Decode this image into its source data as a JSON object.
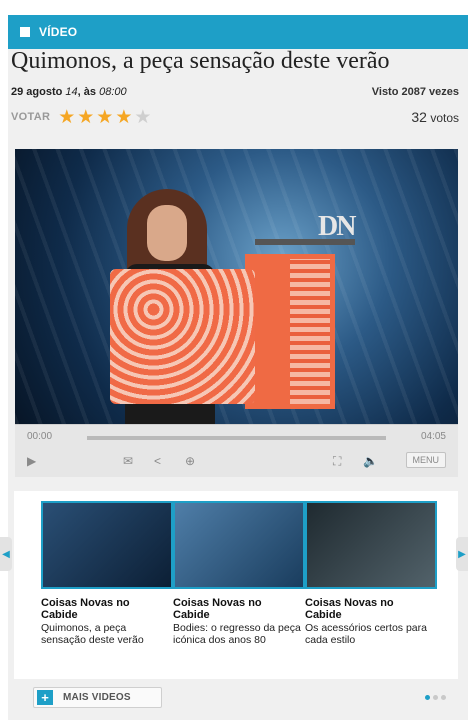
{
  "header": {
    "label": "VÍDEO"
  },
  "article": {
    "title": "Quimonos, a peça sensação deste verão",
    "date_main": "29 agosto",
    "date_year": "14",
    "date_sep": ", às",
    "date_time": "08:00",
    "views": "Visto 2087 vezes"
  },
  "rating": {
    "label": "VOTAR",
    "value": 4,
    "max": 5,
    "votes_number": "32",
    "votes_label": "votos"
  },
  "player": {
    "time_current": "00:00",
    "time_total": "04:05",
    "progress": 0,
    "menu_label": "MENU",
    "logo_text": "DN"
  },
  "carousel": {
    "items": [
      {
        "title": "Coisas Novas no Cabide",
        "desc": "Quimonos, a peça sensação deste verão"
      },
      {
        "title": "Coisas Novas no Cabide",
        "desc": "Bodies: o regresso da peça icónica dos anos 80"
      },
      {
        "title": "Coisas Novas no Cabide",
        "desc": "Os acessórios certos para cada estilo"
      }
    ],
    "more_label": "MAIS VIDEOS",
    "page": 1,
    "pages": 3
  },
  "colors": {
    "accent": "#1e9fc7",
    "star": "#f5a623"
  },
  "icons": [
    "play-icon",
    "email-icon",
    "share-icon",
    "embed-icon",
    "fullscreen-icon",
    "volume-icon",
    "chevron-left-icon",
    "chevron-right-icon",
    "plus-icon"
  ]
}
